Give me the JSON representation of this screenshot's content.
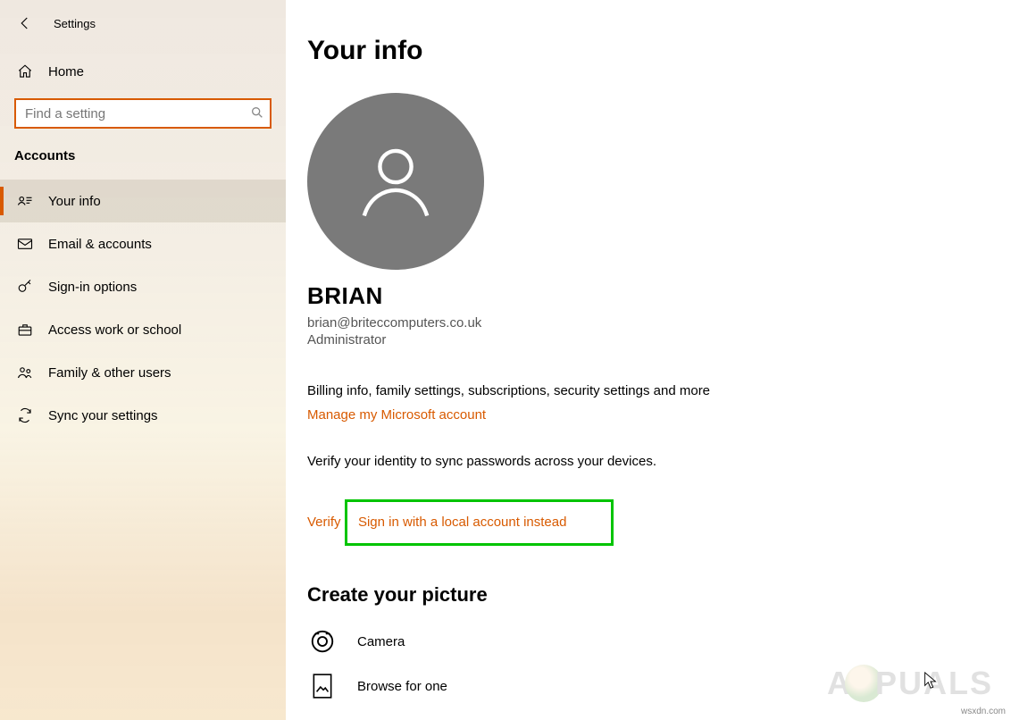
{
  "app": {
    "title": "Settings"
  },
  "sidebar": {
    "home_label": "Home",
    "search_placeholder": "Find a setting",
    "section": "Accounts",
    "items": [
      {
        "label": "Your info"
      },
      {
        "label": "Email & accounts"
      },
      {
        "label": "Sign-in options"
      },
      {
        "label": "Access work or school"
      },
      {
        "label": "Family & other users"
      },
      {
        "label": "Sync your settings"
      }
    ]
  },
  "main": {
    "page_title": "Your info",
    "username": "BRIAN",
    "email": "brian@briteccomputers.co.uk",
    "role": "Administrator",
    "billing_text": "Billing info, family settings, subscriptions, security settings and more",
    "manage_link": "Manage my Microsoft account",
    "verify_text": "Verify your identity to sync passwords across your devices.",
    "verify_link": "Verify",
    "local_account_link": "Sign in with a local account instead",
    "create_picture_title": "Create your picture",
    "camera_label": "Camera",
    "browse_label": "Browse for one"
  },
  "watermark": {
    "left": "A",
    "right": "PUALS",
    "source": "wsxdn.com"
  }
}
